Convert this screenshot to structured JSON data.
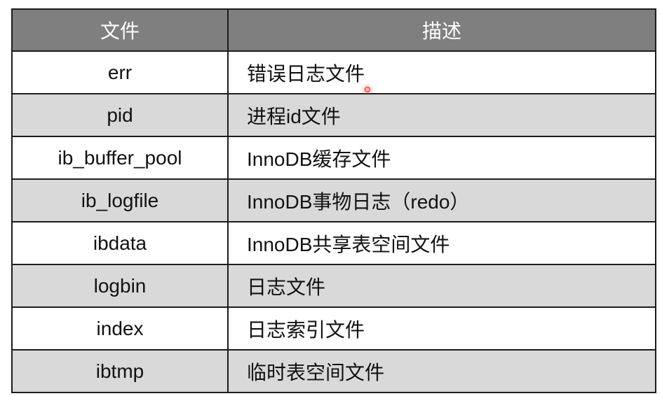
{
  "table": {
    "headers": [
      "文件",
      "描述"
    ],
    "rows": [
      {
        "file": "err",
        "desc": "错误日志文件"
      },
      {
        "file": "pid",
        "desc": "进程id文件"
      },
      {
        "file": "ib_buffer_pool",
        "desc": "InnoDB缓存文件"
      },
      {
        "file": "ib_logfile",
        "desc": "InnoDB事物日志（redo）"
      },
      {
        "file": "ibdata",
        "desc": "InnoDB共享表空间文件"
      },
      {
        "file": "logbin",
        "desc": "日志文件"
      },
      {
        "file": "index",
        "desc": "日志索引文件"
      },
      {
        "file": "ibtmp",
        "desc": "临时表空间文件"
      }
    ]
  },
  "colors": {
    "header_bg": "#7f7f7f",
    "header_text": "#ffffff",
    "row_bg": "#ffffff",
    "row_alt_bg": "#d9d9d9",
    "border": "#1c1c1c",
    "pointer": "#e0302a"
  }
}
